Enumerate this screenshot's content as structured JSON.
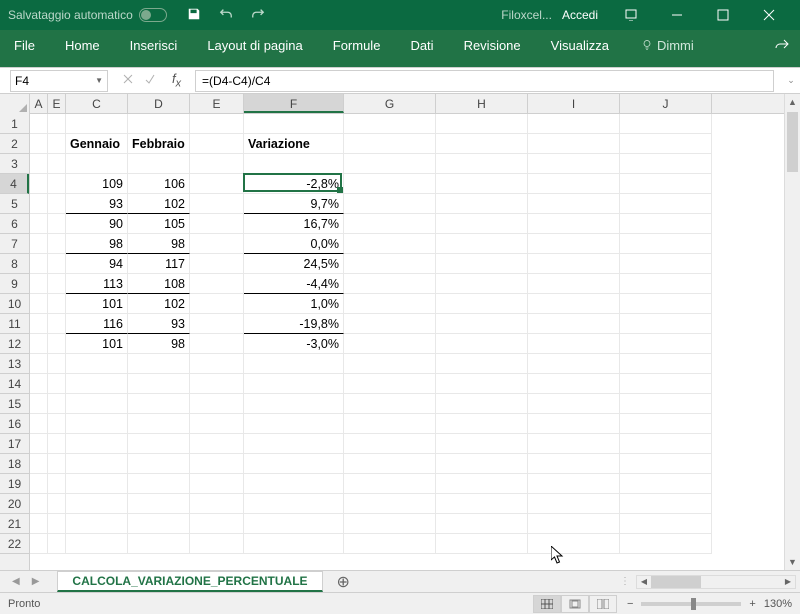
{
  "titlebar": {
    "autosave": "Salvataggio automatico",
    "filename": "Filoxcel...",
    "signin": "Accedi"
  },
  "ribbon": {
    "tabs": [
      "File",
      "Home",
      "Inserisci",
      "Layout di pagina",
      "Formule",
      "Dati",
      "Revisione",
      "Visualizza"
    ],
    "tell": "Dimmi"
  },
  "formula": {
    "namebox": "F4",
    "content": "=(D4-C4)/C4"
  },
  "cols": {
    "A": {
      "w": 18,
      "label": "A"
    },
    "B": {
      "w": 18,
      "label": "E"
    },
    "C": {
      "w": 62,
      "label": "C"
    },
    "D": {
      "w": 62,
      "label": "D"
    },
    "E": {
      "w": 54,
      "label": "E"
    },
    "F": {
      "w": 100,
      "label": "F"
    },
    "G": {
      "w": 92,
      "label": "G"
    },
    "H": {
      "w": 92,
      "label": "H"
    },
    "I": {
      "w": 92,
      "label": "I"
    },
    "J": {
      "w": 92,
      "label": "J"
    }
  },
  "chart_data": {
    "type": "table",
    "title": "",
    "columns": [
      "Gennaio",
      "Febbraio",
      "Variazione"
    ],
    "rows": [
      {
        "gennaio": 109,
        "febbraio": 106,
        "variazione": "-2,8%"
      },
      {
        "gennaio": 93,
        "febbraio": 102,
        "variazione": "9,7%"
      },
      {
        "gennaio": 90,
        "febbraio": 105,
        "variazione": "16,7%"
      },
      {
        "gennaio": 98,
        "febbraio": 98,
        "variazione": "0,0%"
      },
      {
        "gennaio": 94,
        "febbraio": 117,
        "variazione": "24,5%"
      },
      {
        "gennaio": 113,
        "febbraio": 108,
        "variazione": "-4,4%"
      },
      {
        "gennaio": 101,
        "febbraio": 102,
        "variazione": "1,0%"
      },
      {
        "gennaio": 116,
        "febbraio": 93,
        "variazione": "-19,8%"
      },
      {
        "gennaio": 101,
        "febbraio": 98,
        "variazione": "-3,0%"
      }
    ]
  },
  "headers": {
    "c": "Gennaio",
    "d": "Febbraio",
    "f": "Variazione"
  },
  "sheet": {
    "name": "CALCOLA_VARIAZIONE_PERCENTUALE"
  },
  "status": {
    "ready": "Pronto",
    "zoom": "130%"
  }
}
